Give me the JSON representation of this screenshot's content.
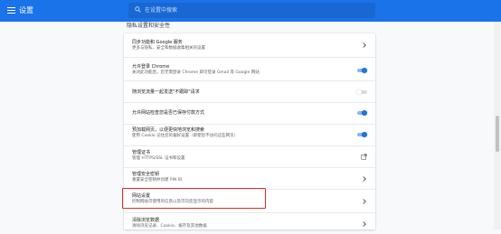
{
  "topbar": {
    "title": "设置",
    "search_placeholder": "在设置中搜索"
  },
  "section": {
    "header": "隐私设置和安全性"
  },
  "rows": [
    {
      "title": "同步功能和 Google 服务",
      "subtitle": "更多与隐私、安全和数据收集相关的设置",
      "control": "chevron"
    },
    {
      "title": "允许登录 Chrome",
      "subtitle": "关闭此功能后，您无需登录 Chrome 即可登录 Gmail 等 Google 网站",
      "control": "toggle",
      "on": true
    },
    {
      "title": "随浏览流量一起发送\"不跟踪\"请求",
      "subtitle": "",
      "control": "toggle",
      "on": false
    },
    {
      "title": "允许网站检查您是否已保存付款方式",
      "subtitle": "",
      "control": "toggle",
      "on": true
    },
    {
      "title": "预加载网页，以便更快地浏览和搜索",
      "subtitle": "使用 Cookie 记住您的偏好设置（即使您不访问这些网页）",
      "control": "toggle",
      "on": true
    },
    {
      "title": "管理证书",
      "subtitle": "管理 HTTPS/SSL 证书和设置",
      "control": "external"
    },
    {
      "title": "管理安全密钥",
      "subtitle": "重置安全密钥并创建 PIN 码",
      "control": "chevron"
    },
    {
      "title": "网站设置",
      "subtitle": "控制网站可使用的信息以及可向您显示的内容",
      "control": "chevron"
    },
    {
      "title": "清除浏览数据",
      "subtitle": "清除浏览记录、Cookie、缓存及其他数据",
      "control": "chevron"
    }
  ],
  "colors": {
    "accent": "#1a73e8",
    "highlight": "#d93025"
  }
}
